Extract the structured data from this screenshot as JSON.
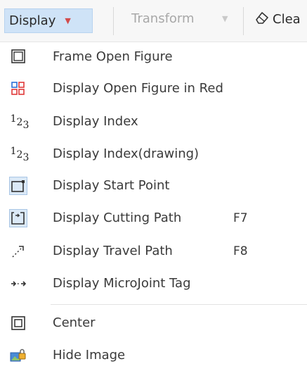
{
  "toolbar": {
    "display_label": "Display",
    "transform_label": "Transform",
    "clear_label": "Clea"
  },
  "menu": {
    "items": [
      {
        "label": "Frame Open Figure",
        "icon": "frame-icon"
      },
      {
        "label": "Display Open Figure in Red",
        "icon": "red-figure-icon"
      },
      {
        "label": "Display Index",
        "icon": "index-icon"
      },
      {
        "label": "Display Index(drawing)",
        "icon": "index-drawing-icon"
      },
      {
        "label": "Display Start Point",
        "icon": "start-point-icon"
      },
      {
        "label": "Display Cutting Path",
        "icon": "cutting-path-icon",
        "shortcut": "F7"
      },
      {
        "label": "Display Travel Path",
        "icon": "travel-path-icon",
        "shortcut": "F8"
      },
      {
        "label": "Display MicroJoint Tag",
        "icon": "microjoint-icon"
      },
      {
        "label": "Center",
        "icon": "center-icon"
      },
      {
        "label": "Hide Image",
        "icon": "hide-image-icon"
      }
    ],
    "index_glyph": [
      "1",
      "2",
      "3"
    ]
  },
  "colors": {
    "accent_bg": "#cfe3f7",
    "red": "#e03a3a",
    "blue": "#2b6fd6"
  }
}
